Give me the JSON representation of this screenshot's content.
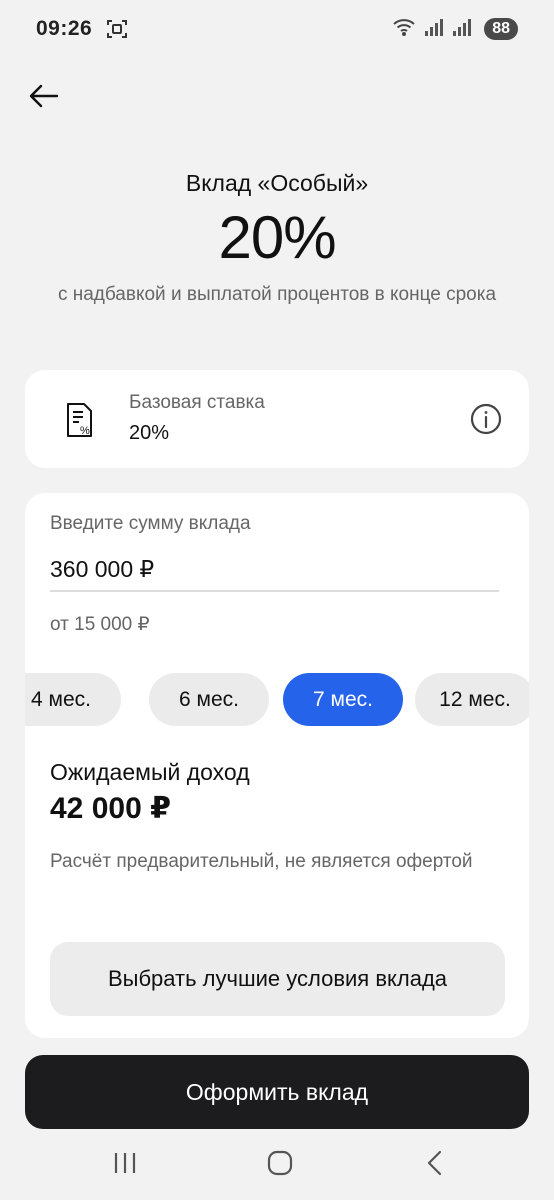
{
  "status_bar": {
    "time": "09:26",
    "battery": "88"
  },
  "deposit": {
    "name": "Вклад «Особый»",
    "rate": "20%",
    "description": "с надбавкой и выплатой процентов в конце срока"
  },
  "base_rate": {
    "label": "Базовая ставка",
    "value": "20%"
  },
  "calculator": {
    "amount_label": "Введите сумму вклада",
    "amount_value": "360 000 ₽",
    "min_amount": "от 15 000 ₽",
    "terms": [
      {
        "label": "4 мес.",
        "selected": false
      },
      {
        "label": "6 мес.",
        "selected": false
      },
      {
        "label": "7 мес.",
        "selected": true
      },
      {
        "label": "12 мес.",
        "selected": false
      }
    ],
    "income_label": "Ожидаемый доход",
    "income_value": "42 000 ₽",
    "disclaimer": "Расчёт предварительный, не является офертой",
    "best_terms_label": "Выбрать лучшие условия вклада"
  },
  "primary_action": {
    "label": "Оформить вклад"
  },
  "colors": {
    "accent": "#2563eb",
    "primary_button": "#1c1c1e",
    "background": "#f2f2f2"
  },
  "icons": [
    "screenshot-icon",
    "wifi-icon",
    "signal-icon",
    "back-arrow-icon",
    "document-percent-icon",
    "info-icon",
    "recent-apps-icon",
    "home-icon",
    "nav-back-icon"
  ]
}
